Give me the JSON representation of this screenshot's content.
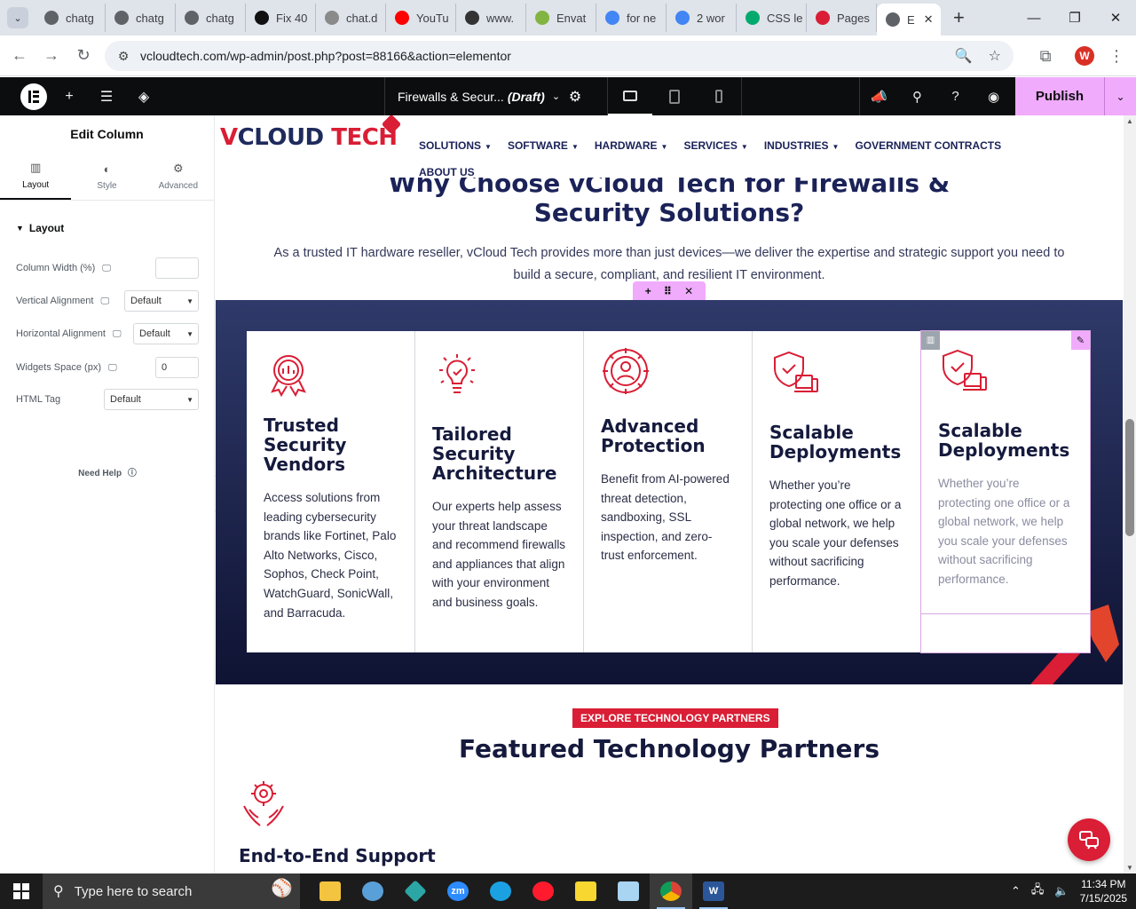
{
  "browser": {
    "tabs": [
      {
        "title": "chatg",
        "icon": "globe-icon",
        "color": "#5f6368"
      },
      {
        "title": "chatg",
        "icon": "globe-icon",
        "color": "#5f6368"
      },
      {
        "title": "chatg",
        "icon": "globe-icon",
        "color": "#5f6368"
      },
      {
        "title": "Fix 40",
        "icon": "github-icon",
        "color": "#111111"
      },
      {
        "title": "chat.d",
        "icon": "deepseek-icon",
        "color": "#8a8a8a"
      },
      {
        "title": "YouTu",
        "icon": "youtube-icon",
        "color": "#ff0000"
      },
      {
        "title": "www.",
        "icon": "wix-icon",
        "color": "#333333"
      },
      {
        "title": "Envat",
        "icon": "envato-icon",
        "color": "#81b441"
      },
      {
        "title": "for ne",
        "icon": "google-icon",
        "color": "#4285f4"
      },
      {
        "title": "2 wor",
        "icon": "google-icon",
        "color": "#4285f4"
      },
      {
        "title": "CSS le",
        "icon": "w3-icon",
        "color": "#04aa6d"
      },
      {
        "title": "Pages",
        "icon": "elementor-diamond-icon",
        "color": "#d91e35"
      }
    ],
    "active_tab": {
      "title": "E",
      "icon": "globe-icon"
    },
    "url": "vcloudtech.com/wp-admin/post.php?post=88166&action=elementor",
    "profile_letter": "W"
  },
  "elementor": {
    "page_title": "Firewalls & Secur...",
    "status": "(Draft)",
    "publish_label": "Publish",
    "panel": {
      "title": "Edit Column",
      "tabs": [
        {
          "label": "Layout",
          "icon": "columns-icon"
        },
        {
          "label": "Style",
          "icon": "half-circle-icon"
        },
        {
          "label": "Advanced",
          "icon": "gear-icon"
        }
      ],
      "section_label": "Layout",
      "controls": {
        "column_width": {
          "label": "Column Width (%)",
          "value": ""
        },
        "vertical_alignment": {
          "label": "Vertical Alignment",
          "value": "Default"
        },
        "horizontal_alignment": {
          "label": "Horizontal Alignment",
          "value": "Default"
        },
        "widgets_space": {
          "label": "Widgets Space (px)",
          "value": "0"
        },
        "html_tag": {
          "label": "HTML Tag",
          "value": "Default"
        }
      },
      "need_help": "Need Help"
    }
  },
  "site": {
    "logo_v": "V",
    "logo_cloud": "CLOUD",
    "logo_tech": "TECH",
    "menu": [
      {
        "label": "SOLUTIONS",
        "has_dropdown": true
      },
      {
        "label": "SOFTWARE",
        "has_dropdown": true
      },
      {
        "label": "HARDWARE",
        "has_dropdown": true
      },
      {
        "label": "SERVICES",
        "has_dropdown": true
      },
      {
        "label": "INDUSTRIES",
        "has_dropdown": true
      },
      {
        "label": "GOVERNMENT CONTRACTS",
        "has_dropdown": false
      },
      {
        "label": "ABOUT US",
        "has_dropdown": false
      }
    ],
    "why_heading_line1": "Why Choose vCloud Tech for Firewalls &",
    "why_heading_line2": "Security Solutions?",
    "why_description": "As a trusted IT hardware reseller, vCloud Tech provides more than just devices—we deliver the expertise and strategic support you need to build a secure, compliant, and resilient IT environment.",
    "cards": [
      {
        "title": "Trusted Security Vendors",
        "description": "Access solutions from leading cybersecurity brands like Fortinet, Palo Alto Networks, Cisco, Sophos, Check Point, WatchGuard, SonicWall, and Barracuda.",
        "icon": "award-badge-icon"
      },
      {
        "title": "Tailored Security Architecture",
        "description": "Our experts help assess your threat landscape and recommend firewalls and appliances that align with your environment and business goals.",
        "icon": "lightbulb-gear-icon"
      },
      {
        "title": "Advanced Protection",
        "description": "Benefit from AI-powered threat detection, sandboxing, SSL inspection, and zero-trust enforcement.",
        "icon": "gear-person-icon"
      },
      {
        "title": "Scalable Deployments",
        "description": "Whether you’re protecting one office or a global network, we help you scale your defenses without sacrificing performance.",
        "icon": "shield-devices-icon"
      },
      {
        "title": "Scalable Deployments",
        "description": "Whether you’re protecting one office or a global network, we help you scale your defenses without sacrificing performance.",
        "icon": "shield-devices-icon"
      }
    ],
    "explore_badge": "EXPLORE TECHNOLOGY PARTNERS",
    "featured_heading": "Featured Technology Partners",
    "support_heading": "End-to-End Support"
  },
  "taskbar": {
    "search_placeholder": "Type here to search",
    "time": "11:34 PM",
    "date": "7/15/2025"
  },
  "colors": {
    "brand_red": "#d91e35",
    "brand_navy": "#1a2258",
    "elementor_pink": "#f0abfc"
  }
}
